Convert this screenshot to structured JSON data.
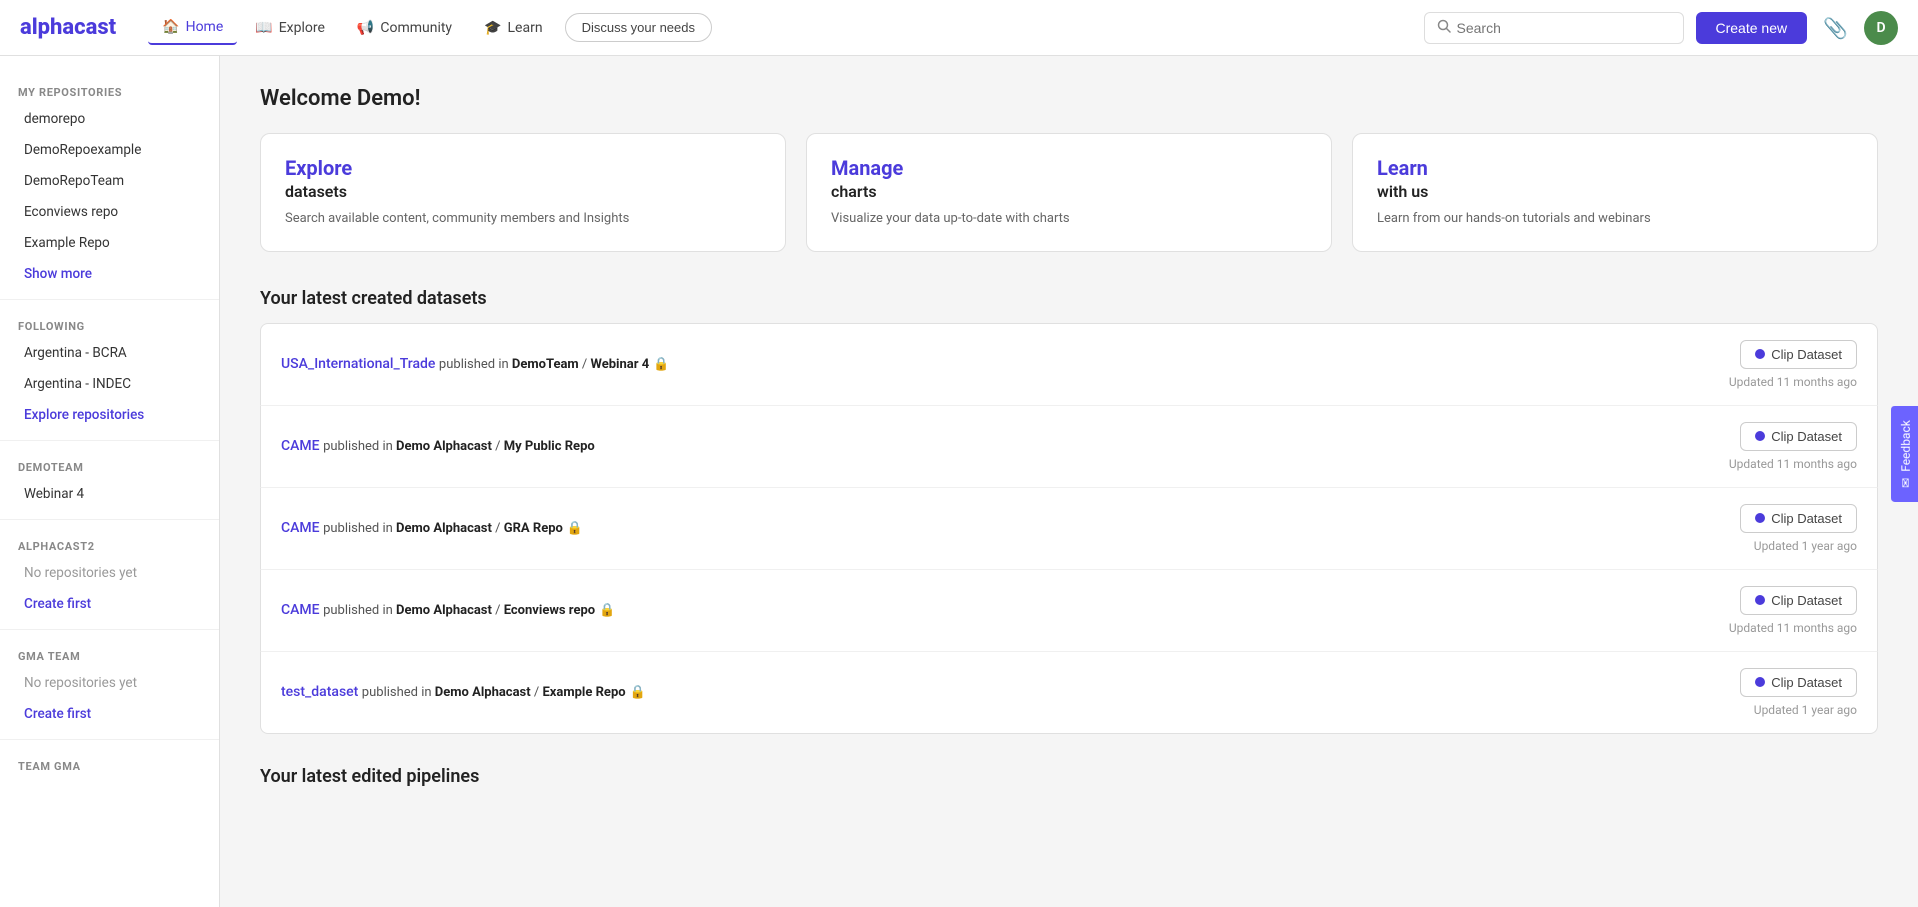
{
  "app": {
    "logo": "alphacast"
  },
  "navbar": {
    "links": [
      {
        "id": "home",
        "label": "Home",
        "icon": "🏠",
        "active": true
      },
      {
        "id": "explore",
        "label": "Explore",
        "icon": "📖",
        "active": false
      },
      {
        "id": "community",
        "label": "Community",
        "icon": "📢",
        "active": false
      },
      {
        "id": "learn",
        "label": "Learn",
        "icon": "🎓",
        "active": false
      }
    ],
    "discuss_label": "Discuss your needs",
    "search_placeholder": "Search",
    "create_label": "Create new",
    "avatar_letter": "D"
  },
  "sidebar": {
    "my_repos_label": "MY REPOSITORIES",
    "repos": [
      "demorepo",
      "DemoRepoexample",
      "DemoRepoTeam",
      "Econviews repo",
      "Example Repo"
    ],
    "show_more_label": "Show more",
    "following_label": "FOLLOWING",
    "following_items": [
      "Argentina - BCRA",
      "Argentina - INDEC"
    ],
    "explore_repos_label": "Explore repositories",
    "demoteam_label": "DEMOTEAM",
    "demoteam_items": [
      "Webinar 4"
    ],
    "alphacast2_label": "ALPHACAST2",
    "alphacast2_no_repos": "No repositories yet",
    "alphacast2_create": "Create first",
    "gma_team_label": "GMA TEAM",
    "gma_team_no_repos": "No repositories yet",
    "gma_team_create": "Create first",
    "team_gma_label": "TEAM GMA"
  },
  "main": {
    "welcome_title": "Welcome Demo!",
    "feature_cards": [
      {
        "id": "explore",
        "title": "Explore",
        "subtitle": "datasets",
        "desc": "Search available content, community members and Insights"
      },
      {
        "id": "manage",
        "title": "Manage",
        "subtitle": "charts",
        "desc": "Visualize your data up-to-date with charts"
      },
      {
        "id": "learn",
        "title": "Learn",
        "subtitle": "with us",
        "desc": "Learn from our hands-on tutorials and webinars"
      }
    ],
    "latest_datasets_title": "Your latest created datasets",
    "datasets": [
      {
        "name": "USA_International_Trade",
        "published_in": "published in",
        "publisher": "DemoTeam / Webinar 4",
        "locked": true,
        "updated": "Updated 11 months ago",
        "clip_label": "Clip Dataset"
      },
      {
        "name": "CAME",
        "published_in": "published in",
        "publisher": "Demo Alphacast / My Public Repo",
        "locked": false,
        "updated": "Updated 11 months ago",
        "clip_label": "Clip Dataset"
      },
      {
        "name": "CAME",
        "published_in": "published in",
        "publisher": "Demo Alphacast / GRA Repo",
        "locked": true,
        "updated": "Updated 1 year ago",
        "clip_label": "Clip Dataset"
      },
      {
        "name": "CAME",
        "published_in": "published in",
        "publisher": "Demo Alphacast / Econviews repo",
        "locked": true,
        "updated": "Updated 11 months ago",
        "clip_label": "Clip Dataset"
      },
      {
        "name": "test_dataset",
        "published_in": "published in",
        "publisher": "Demo Alphacast / Example Repo",
        "locked": true,
        "updated": "Updated 1 year ago",
        "clip_label": "Clip Dataset"
      }
    ],
    "latest_pipelines_title": "Your latest edited pipelines"
  },
  "feedback": {
    "label": "Feedback",
    "icon": "✉"
  }
}
